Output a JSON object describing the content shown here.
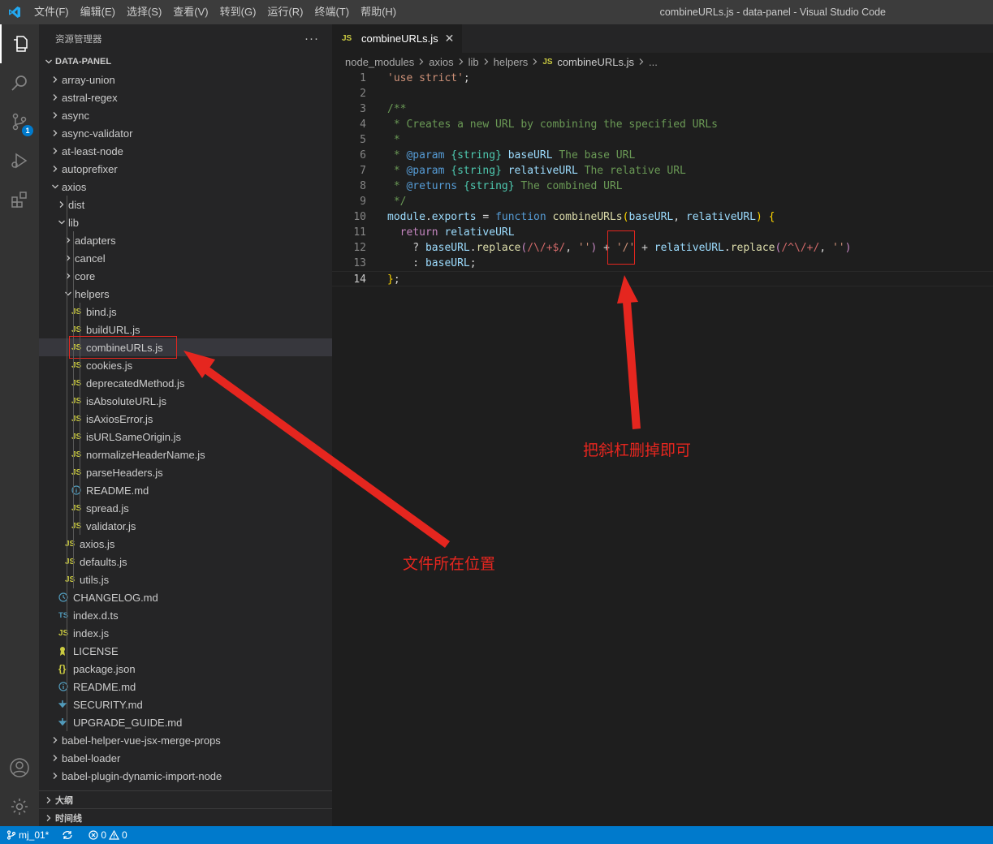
{
  "titlebar": {
    "menus": [
      "文件(F)",
      "编辑(E)",
      "选择(S)",
      "查看(V)",
      "转到(G)",
      "运行(R)",
      "终端(T)",
      "帮助(H)"
    ],
    "window_title": "combineURLs.js - data-panel - Visual Studio Code"
  },
  "activity": {
    "scm_badge": "1"
  },
  "sidebar": {
    "header": "资源管理器",
    "more": "···",
    "section": "DATA-PANEL",
    "tree": [
      {
        "label": "array-union",
        "type": "folder",
        "depth": 0,
        "expanded": false
      },
      {
        "label": "astral-regex",
        "type": "folder",
        "depth": 0,
        "expanded": false
      },
      {
        "label": "async",
        "type": "folder",
        "depth": 0,
        "expanded": false
      },
      {
        "label": "async-validator",
        "type": "folder",
        "depth": 0,
        "expanded": false
      },
      {
        "label": "at-least-node",
        "type": "folder",
        "depth": 0,
        "expanded": false
      },
      {
        "label": "autoprefixer",
        "type": "folder",
        "depth": 0,
        "expanded": false
      },
      {
        "label": "axios",
        "type": "folder",
        "depth": 0,
        "expanded": true
      },
      {
        "label": "dist",
        "type": "folder",
        "depth": 1,
        "expanded": false
      },
      {
        "label": "lib",
        "type": "folder",
        "depth": 1,
        "expanded": true
      },
      {
        "label": "adapters",
        "type": "folder",
        "depth": 2,
        "expanded": false
      },
      {
        "label": "cancel",
        "type": "folder",
        "depth": 2,
        "expanded": false
      },
      {
        "label": "core",
        "type": "folder",
        "depth": 2,
        "expanded": false
      },
      {
        "label": "helpers",
        "type": "folder",
        "depth": 2,
        "expanded": true
      },
      {
        "label": "bind.js",
        "type": "js",
        "depth": 3
      },
      {
        "label": "buildURL.js",
        "type": "js",
        "depth": 3
      },
      {
        "label": "combineURLs.js",
        "type": "js",
        "depth": 3,
        "selected": true
      },
      {
        "label": "cookies.js",
        "type": "js",
        "depth": 3
      },
      {
        "label": "deprecatedMethod.js",
        "type": "js",
        "depth": 3
      },
      {
        "label": "isAbsoluteURL.js",
        "type": "js",
        "depth": 3
      },
      {
        "label": "isAxiosError.js",
        "type": "js",
        "depth": 3
      },
      {
        "label": "isURLSameOrigin.js",
        "type": "js",
        "depth": 3
      },
      {
        "label": "normalizeHeaderName.js",
        "type": "js",
        "depth": 3
      },
      {
        "label": "parseHeaders.js",
        "type": "js",
        "depth": 3
      },
      {
        "label": "README.md",
        "type": "info",
        "depth": 3
      },
      {
        "label": "spread.js",
        "type": "js",
        "depth": 3
      },
      {
        "label": "validator.js",
        "type": "js",
        "depth": 3
      },
      {
        "label": "axios.js",
        "type": "js",
        "depth": 2
      },
      {
        "label": "defaults.js",
        "type": "js",
        "depth": 2
      },
      {
        "label": "utils.js",
        "type": "js",
        "depth": 2
      },
      {
        "label": "CHANGELOG.md",
        "type": "clock",
        "depth": 1
      },
      {
        "label": "index.d.ts",
        "type": "ts",
        "depth": 1
      },
      {
        "label": "index.js",
        "type": "js",
        "depth": 1
      },
      {
        "label": "LICENSE",
        "type": "license",
        "depth": 1
      },
      {
        "label": "package.json",
        "type": "json",
        "depth": 1
      },
      {
        "label": "README.md",
        "type": "info",
        "depth": 1
      },
      {
        "label": "SECURITY.md",
        "type": "md",
        "depth": 1
      },
      {
        "label": "UPGRADE_GUIDE.md",
        "type": "md",
        "depth": 1
      },
      {
        "label": "babel-helper-vue-jsx-merge-props",
        "type": "folder",
        "depth": 0,
        "expanded": false
      },
      {
        "label": "babel-loader",
        "type": "folder",
        "depth": 0,
        "expanded": false
      },
      {
        "label": "babel-plugin-dynamic-import-node",
        "type": "folder",
        "depth": 0,
        "expanded": false
      }
    ],
    "outline": "大纲",
    "timeline": "时间线"
  },
  "editor": {
    "tab_label": "combineURLs.js",
    "tab_icon": "JS",
    "breadcrumb": [
      "node_modules",
      "axios",
      "lib",
      "helpers"
    ],
    "breadcrumb_file": "combineURLs.js",
    "breadcrumb_tail": "...",
    "current_line": 14,
    "lines": [
      [
        [
          "c-str",
          "'use strict'"
        ],
        [
          "c-pl",
          ";"
        ]
      ],
      [],
      [
        [
          "c-com",
          "/**"
        ]
      ],
      [
        [
          "c-com",
          " * Creates a new URL by combining the specified URLs"
        ]
      ],
      [
        [
          "c-com",
          " *"
        ]
      ],
      [
        [
          "c-com",
          " * "
        ],
        [
          "c-kw",
          "@param"
        ],
        [
          "c-com",
          " "
        ],
        [
          "c-typ",
          "{string}"
        ],
        [
          "c-com",
          " "
        ],
        [
          "c-var",
          "baseURL"
        ],
        [
          "c-com",
          " The base URL"
        ]
      ],
      [
        [
          "c-com",
          " * "
        ],
        [
          "c-kw",
          "@param"
        ],
        [
          "c-com",
          " "
        ],
        [
          "c-typ",
          "{string}"
        ],
        [
          "c-com",
          " "
        ],
        [
          "c-var",
          "relativeURL"
        ],
        [
          "c-com",
          " The relative URL"
        ]
      ],
      [
        [
          "c-com",
          " * "
        ],
        [
          "c-kw",
          "@returns"
        ],
        [
          "c-com",
          " "
        ],
        [
          "c-typ",
          "{string}"
        ],
        [
          "c-com",
          " The combined URL"
        ]
      ],
      [
        [
          "c-com",
          " */"
        ]
      ],
      [
        [
          "c-var",
          "module"
        ],
        [
          "c-pl",
          "."
        ],
        [
          "c-var",
          "exports"
        ],
        [
          "c-pl",
          " = "
        ],
        [
          "c-kw",
          "function"
        ],
        [
          "c-pl",
          " "
        ],
        [
          "c-fn",
          "combineURLs"
        ],
        [
          "c-br",
          "("
        ],
        [
          "c-var",
          "baseURL"
        ],
        [
          "c-pl",
          ", "
        ],
        [
          "c-var",
          "relativeURL"
        ],
        [
          "c-br",
          ")"
        ],
        [
          "c-pl",
          " "
        ],
        [
          "c-br",
          "{"
        ]
      ],
      [
        [
          "c-pl",
          "  "
        ],
        [
          "c-ctl",
          "return"
        ],
        [
          "c-pl",
          " "
        ],
        [
          "c-var",
          "relativeURL"
        ]
      ],
      [
        [
          "c-pl",
          "    ? "
        ],
        [
          "c-var",
          "baseURL"
        ],
        [
          "c-pl",
          "."
        ],
        [
          "c-fn",
          "replace"
        ],
        [
          "c-ctl",
          "("
        ],
        [
          "c-rx",
          "/\\/+$/"
        ],
        [
          "c-pl",
          ", "
        ],
        [
          "c-str",
          "''"
        ],
        [
          "c-ctl",
          ")"
        ],
        [
          "c-pl",
          " + "
        ],
        [
          "c-str",
          "'/'"
        ],
        [
          "c-pl",
          " + "
        ],
        [
          "c-var",
          "relativeURL"
        ],
        [
          "c-pl",
          "."
        ],
        [
          "c-fn",
          "replace"
        ],
        [
          "c-ctl",
          "("
        ],
        [
          "c-rx",
          "/^\\/+/"
        ],
        [
          "c-pl",
          ", "
        ],
        [
          "c-str",
          "''"
        ],
        [
          "c-ctl",
          ")"
        ]
      ],
      [
        [
          "c-pl",
          "    : "
        ],
        [
          "c-var",
          "baseURL"
        ],
        [
          "c-pl",
          ";"
        ]
      ],
      [
        [
          "c-br",
          "}"
        ],
        [
          "c-pl",
          ";"
        ]
      ]
    ]
  },
  "annotations": {
    "slash_note": "把斜杠删掉即可",
    "file_note": "文件所在位置",
    "color": "#e5261f"
  },
  "statusbar": {
    "branch": "mj_01*",
    "errors": "0",
    "warnings": "0"
  }
}
